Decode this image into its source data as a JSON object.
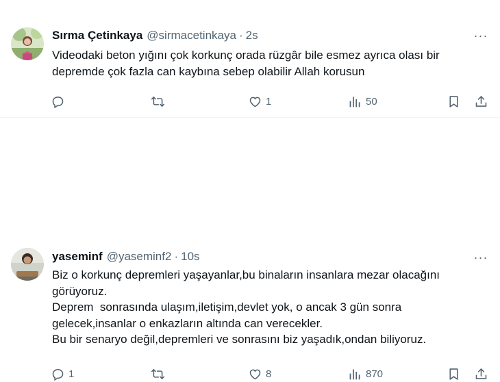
{
  "tweets": [
    {
      "display_name": "Sırma Çetinkaya",
      "handle": "@sirmacetinkaya",
      "separator": "·",
      "time": "2s",
      "text_lines": [
        "Videodaki beton yığını çok korkunç orada rüzgâr bile esmez ayrıca olası bir\ndepremde çok fazla can kaybına sebep olabilir Allah korusun"
      ],
      "reply_count": "",
      "retweet_count": "",
      "like_count": "1",
      "view_count": "50",
      "avatar_icon": "profile-avatar"
    },
    {
      "display_name": "yaseminf",
      "handle": "@yaseminf2",
      "separator": "·",
      "time": "10s",
      "text_lines": [
        "Biz o korkunç depremleri yaşayanlar,bu binaların insanlara mezar olacağını\ngörüyoruz.",
        "Deprem  sonrasında ulaşım,iletişim,devlet yok, o ancak 3 gün sonra\ngelecek,insanlar o enkazların altında can verecekler.",
        "Bu bir senaryo değil,depremleri ve sonrasını biz yaşadık,ondan biliyoruz."
      ],
      "reply_count": "1",
      "retweet_count": "",
      "like_count": "8",
      "view_count": "870",
      "avatar_icon": "profile-avatar"
    }
  ],
  "icons": {
    "more": "more-horizontal-icon",
    "reply": "reply-icon",
    "retweet": "retweet-icon",
    "like": "like-icon",
    "views": "views-icon",
    "bookmark": "bookmark-icon",
    "share": "share-icon"
  },
  "colors": {
    "text": "#0f1419",
    "secondary": "#536471",
    "divider": "#eff3f4"
  }
}
